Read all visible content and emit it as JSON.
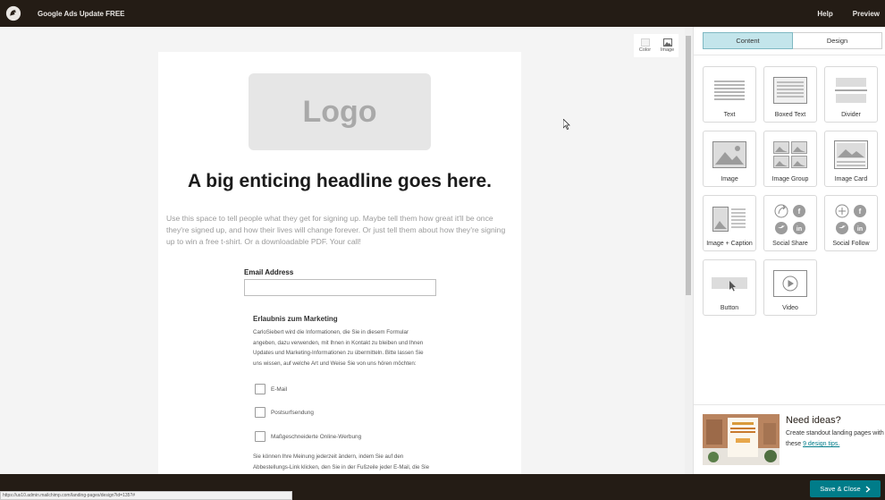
{
  "app": {
    "title": "Google Ads Update FREE",
    "help_label": "Help",
    "preview_label": "Preview"
  },
  "canvas": {
    "logo_text": "Logo",
    "headline": "A big enticing headline goes here.",
    "intro": "Use this space to tell people what they get for signing up. Maybe tell them how great it'll be once they're signed up, and how their lives will change forever. Or just tell them about how they're signing up to win a free t-shirt. Or a downloadable PDF. Your call!",
    "email_label": "Email Address",
    "email_value": "",
    "marketing_title": "Erlaubnis zum Marketing",
    "marketing_text": "CarloSiebert wird die Informationen, die Sie in diesem Formular angeben, dazu verwenden, mit Ihnen in Kontakt zu bleiben und Ihnen Updates und Marketing-Informationen zu übermitteln. Bitte lassen Sie uns wissen, auf welche Art und Weise Sie von uns hören möchten:",
    "options": [
      "E-Mail",
      "Postsurfsendung",
      "Maßgeschneiderte Online-Werbung"
    ],
    "marketing_bottom": "Sie können Ihre Meinung jederzeit ändern, indem Sie auf den Abbestellungs-Link klicken, den Sie in der Fußzeile jeder E-Mail, die Sie von uns erhalten, finden können, oder indem Sie uns"
  },
  "mini_toolbar": {
    "color_label": "Color",
    "image_label": "Image"
  },
  "panel": {
    "tabs": [
      {
        "label": "Content",
        "active": true
      },
      {
        "label": "Design",
        "active": false
      }
    ],
    "blocks": [
      {
        "label": "Text",
        "icon": "text-block-icon"
      },
      {
        "label": "Boxed Text",
        "icon": "boxed-text-icon"
      },
      {
        "label": "Divider",
        "icon": "divider-icon"
      },
      {
        "label": "Image",
        "icon": "image-icon"
      },
      {
        "label": "Image Group",
        "icon": "image-group-icon"
      },
      {
        "label": "Image Card",
        "icon": "image-card-icon"
      },
      {
        "label": "Image + Caption",
        "icon": "image-caption-icon"
      },
      {
        "label": "Social Share",
        "icon": "social-share-icon"
      },
      {
        "label": "Social Follow",
        "icon": "social-follow-icon"
      },
      {
        "label": "Button",
        "icon": "button-icon"
      },
      {
        "label": "Video",
        "icon": "video-icon"
      }
    ],
    "ideas_title": "Need ideas?",
    "ideas_text_prefix": "Create standout landing pages with these",
    "ideas_link": "9 design tips."
  },
  "footer": {
    "save_label": "Save & Close",
    "status_url": "https://us10.admin.mailchimp.com/landing-pages/design?id=135?#"
  },
  "colors": {
    "topbar": "#241c15",
    "accent": "#007c89",
    "tab_active": "#c3e5eb"
  }
}
